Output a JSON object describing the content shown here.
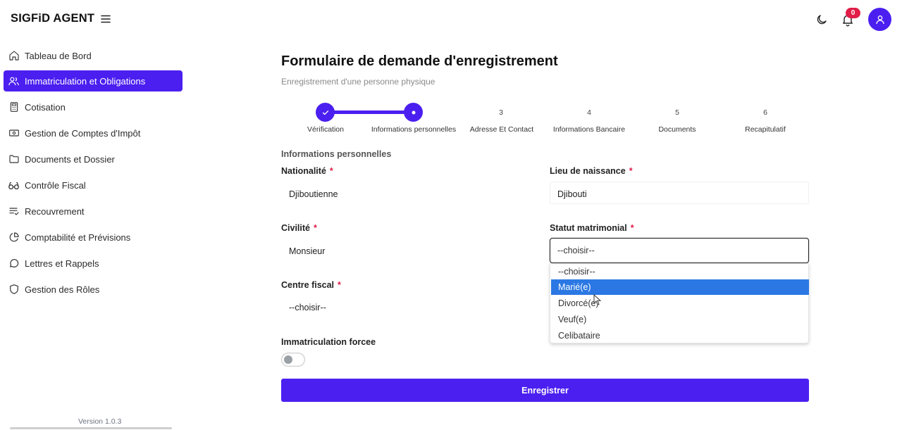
{
  "app": {
    "title": "SIGFiD AGENT",
    "notifications_count": "0",
    "version": "Version 1.0.3",
    "accent_color": "#4b1ff0"
  },
  "sidebar": {
    "items": [
      {
        "label": "Tableau de Bord",
        "icon": "home-icon",
        "active": false
      },
      {
        "label": "Immatriculation et Obligations",
        "icon": "users-icon",
        "active": true
      },
      {
        "label": "Cotisation",
        "icon": "calculator-icon",
        "active": false
      },
      {
        "label": "Gestion de Comptes d'Impôt",
        "icon": "banknote-icon",
        "active": false
      },
      {
        "label": "Documents et Dossier",
        "icon": "folder-icon",
        "active": false
      },
      {
        "label": "Contrôle Fiscal",
        "icon": "glasses-icon",
        "active": false
      },
      {
        "label": "Recouvrement",
        "icon": "list-check-icon",
        "active": false
      },
      {
        "label": "Comptabilité et Prévisions",
        "icon": "pie-chart-icon",
        "active": false
      },
      {
        "label": "Lettres et Rappels",
        "icon": "message-circle-icon",
        "active": false
      },
      {
        "label": "Gestion des Rôles",
        "icon": "shield-icon",
        "active": false
      }
    ]
  },
  "page": {
    "title": "Formulaire de demande d'enregistrement",
    "subtitle": "Enregistrement d'une personne physique"
  },
  "stepper": {
    "steps": [
      {
        "number": "",
        "label": "Vérification",
        "state": "done"
      },
      {
        "number": "",
        "label": "Informations personnelles",
        "state": "current"
      },
      {
        "number": "3",
        "label": "Adresse Et Contact",
        "state": "pending"
      },
      {
        "number": "4",
        "label": "Informations Bancaire",
        "state": "pending"
      },
      {
        "number": "5",
        "label": "Documents",
        "state": "pending"
      },
      {
        "number": "6",
        "label": "Recapitulatif",
        "state": "pending"
      }
    ]
  },
  "form": {
    "section_title": "Informations personnelles",
    "nationalite": {
      "label": "Nationalité",
      "value": "Djiboutienne"
    },
    "lieu_naissance": {
      "label": "Lieu de naissance",
      "value": "Djibouti"
    },
    "civilite": {
      "label": "Civilité",
      "value": "Monsieur"
    },
    "statut_matrimonial": {
      "label": "Statut matrimonial",
      "value": "--choisir--",
      "dropdown_open": true,
      "options": [
        "--choisir--",
        "Marié(e)",
        "Divorcé(e)",
        "Veuf(e)",
        "Celibataire"
      ],
      "highlighted_option": "Marié(e)"
    },
    "centre_fiscal": {
      "label": "Centre fiscal",
      "value": "--choisir--"
    },
    "immatriculation_forcee": {
      "label": "Immatriculation forcee",
      "enabled": false
    },
    "required_marker": "*",
    "submit_label": "Enregistrer"
  }
}
